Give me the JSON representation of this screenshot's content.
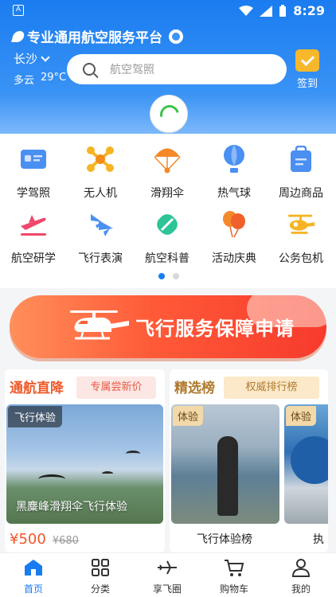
{
  "status_bar": {
    "time": "8:29",
    "app_indicator": "A"
  },
  "header": {
    "brand": "专业通用航空服务平台",
    "city": "长沙",
    "weather_desc": "多云",
    "temperature": "29°C",
    "search": {
      "placeholder": "航空驾照"
    },
    "checkin_label": "签到"
  },
  "categories": [
    {
      "label": "学驾照",
      "icon": "license-card-icon"
    },
    {
      "label": "无人机",
      "icon": "drone-icon"
    },
    {
      "label": "滑翔伞",
      "icon": "parachute-icon"
    },
    {
      "label": "热气球",
      "icon": "hot-air-balloon-icon"
    },
    {
      "label": "周边商品",
      "icon": "shopping-bag-icon"
    },
    {
      "label": "航空研学",
      "icon": "airplane-takeoff-icon"
    },
    {
      "label": "飞行表演",
      "icon": "jets-icon"
    },
    {
      "label": "航空科普",
      "icon": "science-icon"
    },
    {
      "label": "活动庆典",
      "icon": "balloons-icon"
    },
    {
      "label": "公务包机",
      "icon": "helicopter-icon"
    }
  ],
  "pager": {
    "count": 2,
    "active": 0
  },
  "banner": {
    "title": "飞行服务保障申请"
  },
  "card_left": {
    "title": "通航直降",
    "tag": "专属尝新价",
    "photo_badge": "飞行体验",
    "photo_caption": "黑麋峰滑翔伞飞行体验",
    "price": "¥500",
    "original_price": "¥680"
  },
  "card_right": {
    "title": "精选榜",
    "tag": "权威排行榜",
    "item1": {
      "badge": "体验",
      "caption": "飞行体验榜"
    },
    "item2": {
      "badge": "体验",
      "caption": "执"
    }
  },
  "tabbar": [
    {
      "label": "首页",
      "icon": "home-icon",
      "active": true
    },
    {
      "label": "分类",
      "icon": "grid-icon",
      "active": false
    },
    {
      "label": "享飞圈",
      "icon": "airplane-icon",
      "active": false
    },
    {
      "label": "购物车",
      "icon": "cart-icon",
      "active": false
    },
    {
      "label": "我的",
      "icon": "user-icon",
      "active": false
    }
  ],
  "colors": {
    "primary": "#1a7cf0",
    "accent": "#f0562a",
    "gold": "#b07a2f"
  }
}
